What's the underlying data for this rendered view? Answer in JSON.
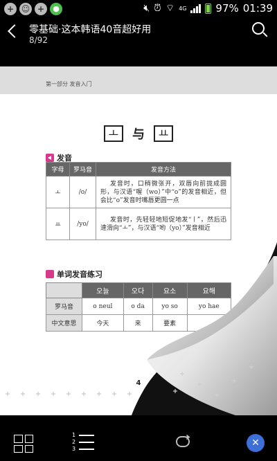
{
  "status": {
    "battery": "97%",
    "time": "01:39",
    "network": "4G"
  },
  "header": {
    "title": "零基础·这本韩语40音超好用",
    "page_counter": "8/92"
  },
  "page": {
    "section_label": "第一部分  发音入门",
    "title_left": "ㅗ",
    "title_mid": "与",
    "title_right": "ㅛ",
    "pronunciation_heading": "发音",
    "pron_table": {
      "headers": [
        "字母",
        "罗马音",
        "发音方法"
      ],
      "rows": [
        {
          "letter": "ㅗ",
          "roman": "/o/",
          "desc": "发音时，口稍微张开，双唇向前拢成圆形，与汉语“喔（wo）”中“o”的发音相近，但会比“o”发音时嘴唇更圆一点"
        },
        {
          "letter": "ㅛ",
          "roman": "/yo/",
          "desc": "发音时，先轻轻地短促地发“ㅣ”，然后迅速滑向“ㅗ”，与汉语“哟（yo）”发音相近"
        }
      ]
    },
    "word_heading": "单词发音练习",
    "word_table": {
      "headers": [
        "오늘",
        "오다",
        "요소",
        "요해"
      ],
      "rows": [
        {
          "label": "罗马音",
          "cells": [
            "o neul",
            "o da",
            "yo so",
            "yo hae"
          ]
        },
        {
          "label": "中文意思",
          "cells": [
            "今天",
            "来",
            "要素",
            ""
          ]
        }
      ]
    },
    "page_number": "4"
  },
  "colors": {
    "accent_pink": "#d63a8a",
    "close_blue": "#3d6fd6",
    "table_header": "#666666"
  }
}
